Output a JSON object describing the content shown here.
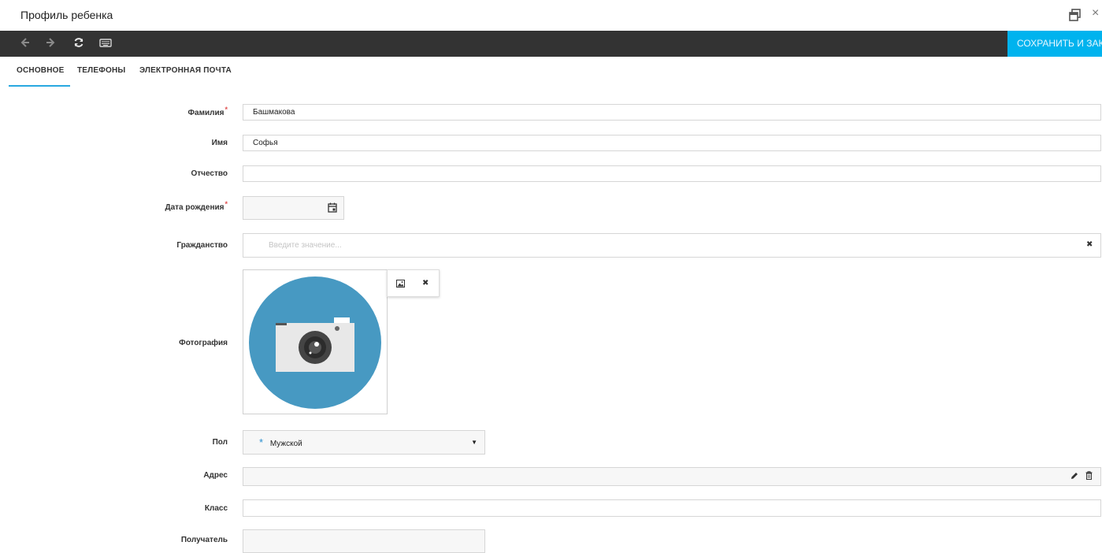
{
  "window": {
    "title": "Профиль ребенка",
    "close_glyph": "×",
    "restore_icon": "window-restore-icon"
  },
  "toolbar": {
    "back_icon": "arrow-left-icon",
    "forward_icon": "arrow-right-icon",
    "refresh_icon": "refresh-icon",
    "keyboard_icon": "keyboard-icon",
    "save_label": "СОХРАНИТЬ И ЗАКРЫТЬ",
    "background": "#333333",
    "accent": "#00b3ee"
  },
  "tabs": [
    {
      "label": "ОСНОВНОЕ",
      "active": true
    },
    {
      "label": "ТЕЛЕФОНЫ",
      "active": false
    },
    {
      "label": "ЭЛЕКТРОННАЯ ПОЧТА",
      "active": false
    }
  ],
  "form": {
    "surname": {
      "label": "Фамилия",
      "required_mark": "*",
      "value": "Башмакова"
    },
    "name": {
      "label": "Имя",
      "value": "Софья"
    },
    "patronymic": {
      "label": "Отчество",
      "value": ""
    },
    "birthdate": {
      "label": "Дата рождения",
      "required_mark": "*",
      "value": "",
      "icon": "calendar-icon"
    },
    "citizenship": {
      "label": "Гражданство",
      "placeholder": "Введите значение...",
      "clear_glyph": "✖"
    },
    "photo": {
      "label": "Фотография",
      "image_icon": "camera-placeholder-icon",
      "upload_icon": "image-icon",
      "delete_glyph": "✖"
    },
    "gender": {
      "label": "Пол",
      "marker": "*",
      "value": "Мужской",
      "arrow": "▼"
    },
    "address": {
      "label": "Адрес",
      "value": "",
      "edit_icon": "pencil-icon",
      "delete_icon": "trash-icon"
    },
    "class": {
      "label": "Класс",
      "value": ""
    },
    "cut_off_label": "Получатель"
  }
}
